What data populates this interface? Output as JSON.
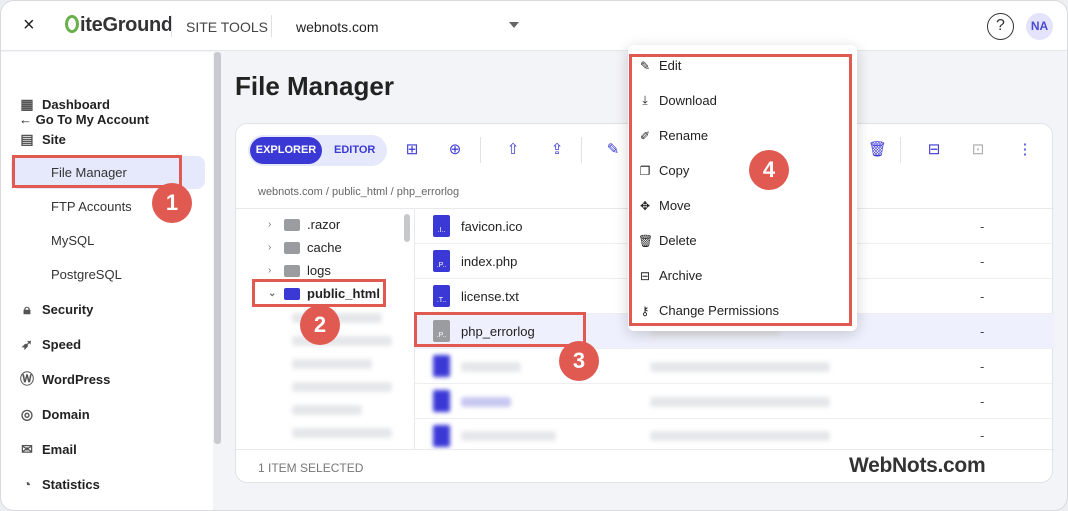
{
  "header": {
    "close_icon": "×",
    "logo_text": "iteGround",
    "site_tools": "SITE TOOLS",
    "domain": "webnots.com",
    "help": "?",
    "avatar": "NA"
  },
  "sidebar": {
    "back": "← Go To My Account",
    "items": [
      {
        "label": "Dashboard",
        "icon": "dashboard-icon"
      },
      {
        "label": "Site",
        "icon": "site-icon"
      },
      {
        "label": "Security",
        "icon": "lock-icon"
      },
      {
        "label": "Speed",
        "icon": "rocket-icon"
      },
      {
        "label": "WordPress",
        "icon": "wordpress-icon"
      },
      {
        "label": "Domain",
        "icon": "globe-icon"
      },
      {
        "label": "Email",
        "icon": "mail-icon"
      },
      {
        "label": "Statistics",
        "icon": "chart-icon"
      }
    ],
    "site_sub": [
      "File Manager",
      "FTP Accounts",
      "MySQL",
      "PostgreSQL"
    ]
  },
  "main": {
    "title": "File Manager",
    "toggle": {
      "explorer": "EXPLORER",
      "editor": "EDITOR"
    },
    "breadcrumb": "webnots.com / public_html / php_errorlog",
    "tree": [
      ".razor",
      "cache",
      "logs",
      "public_html"
    ],
    "files": [
      {
        "name": "favicon.ico",
        "ext": ".I..",
        "size": "-"
      },
      {
        "name": "index.php",
        "ext": ".P..",
        "size": "-"
      },
      {
        "name": "license.txt",
        "ext": ".T..",
        "size": "-"
      },
      {
        "name": "php_errorlog",
        "ext": ".P..",
        "size": "-"
      },
      {
        "name": "",
        "ext": "",
        "size": "-"
      },
      {
        "name": "",
        "ext": "",
        "size": "-"
      },
      {
        "name": "",
        "ext": "",
        "size": "-"
      }
    ],
    "status": "1 ITEM SELECTED"
  },
  "context_menu": [
    {
      "label": "Edit",
      "icon": "pencil-icon"
    },
    {
      "label": "Download",
      "icon": "download-icon"
    },
    {
      "label": "Rename",
      "icon": "rename-icon"
    },
    {
      "label": "Copy",
      "icon": "copy-icon"
    },
    {
      "label": "Move",
      "icon": "move-icon"
    },
    {
      "label": "Delete",
      "icon": "trash-icon"
    },
    {
      "label": "Archive",
      "icon": "archive-icon"
    },
    {
      "label": "Change Permissions",
      "icon": "key-icon"
    }
  ],
  "annotations": [
    "1",
    "2",
    "3",
    "4"
  ],
  "watermark": "WebNots.com",
  "colors": {
    "accent": "#3b39d6",
    "highlight": "#e15a52",
    "active_bg": "#e6e9fc"
  }
}
